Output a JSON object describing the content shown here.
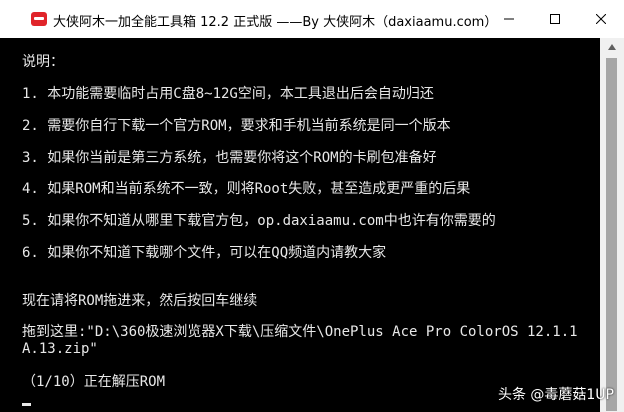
{
  "window": {
    "title": "大侠阿木一加全能工具箱 12.2 正式版 ——By 大侠阿木（daxiaamu.com）"
  },
  "console": {
    "lines": [
      "说明：",
      "1. 本功能需要临时占用C盘8~12G空间，本工具退出后会自动归还",
      "2. 需要你自行下载一个官方ROM，要求和手机当前系统是同一个版本",
      "3. 如果你当前是第三方系统，也需要你将这个ROM的卡刷包准备好",
      "4. 如果ROM和当前系统不一致，则将Root失败，甚至造成更严重的后果",
      "5. 如果你不知道从哪里下载官方包，op.daxiaamu.com中也许有你需要的",
      "6. 如果你不知道下载哪个文件，可以在QQ频道内请教大家",
      "现在请将ROM拖进来，然后按回车继续",
      "拖到这里:\"D:\\360极速浏览器X下载\\压缩文件\\OnePlus Ace Pro ColorOS 12.1.1",
      "A.13.zip\"",
      "（1/10）正在解压ROM"
    ]
  },
  "watermark": {
    "text": "头条 @毒蘑菇1UP"
  },
  "colors": {
    "titlebar_bg": "#ffffff",
    "console_bg": "#000000",
    "console_text": "#e8e8e8",
    "icon_red": "#e0242a"
  },
  "icons": {
    "app": "app-logo-icon",
    "minimize": "minimize-icon",
    "maximize": "maximize-icon",
    "close": "close-icon"
  }
}
